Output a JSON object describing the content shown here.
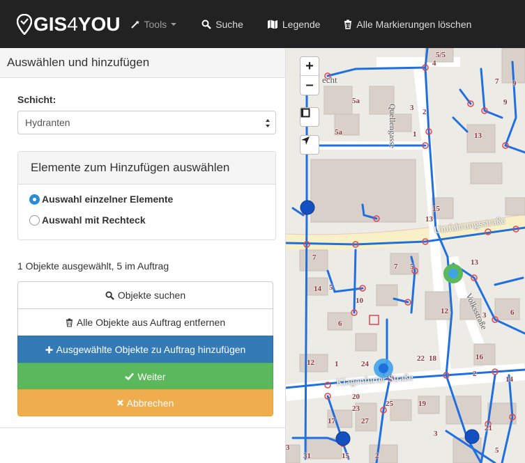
{
  "navbar": {
    "brand_main": "GIS",
    "brand_four": "4",
    "brand_you": "YOU",
    "tools_label": "Tools",
    "search_label": "Suche",
    "legend_label": "Legende",
    "clear_label": "Alle Markierungen löschen"
  },
  "sidebar": {
    "title": "Auswählen und hinzufügen",
    "layer_label": "Schicht:",
    "layer_value": "Hydranten",
    "choose_title": "Elemente zum Hinzufügen auswählen",
    "radio_single": "Auswahl einzelner Elemente",
    "radio_rect": "Auswahl mit Rechteck",
    "radio_selected": "single",
    "status": "1 Objekte ausgewählt, 5 im Auftrag",
    "btn_search": "Objekte suchen",
    "btn_remove_all": "Alle Objekte aus Auftrag entfernen",
    "btn_add": "Ausgewählte Objekte zu Auftrag hinzufügen",
    "btn_next": "Weiter",
    "btn_cancel": "Abbrechen"
  },
  "map": {
    "zoom_in": "+",
    "zoom_out": "–",
    "street_1": "Umfahrungsstraße",
    "street_2": "Klagenfurter Straße",
    "street_3": "Quellengasse",
    "street_4": "Volksstraße",
    "label_top": "echt",
    "house_numbers": [
      "5/5",
      "4",
      "7",
      "9",
      "9",
      "5a",
      "3",
      "2",
      "1",
      "5a",
      "13",
      "13",
      "15",
      "13",
      "7",
      "7",
      "5",
      "14",
      "5",
      "10",
      "12",
      "3",
      "6",
      "6",
      "22",
      "18",
      "16",
      "2",
      "14",
      "12",
      "1",
      "24",
      "20",
      "23",
      "25",
      "19",
      "17",
      "27",
      "21",
      "3",
      "15",
      "2",
      "3",
      "5",
      "31",
      "7"
    ],
    "colors": {
      "pipe": "#1f6fe0",
      "building": "#d9d0c9",
      "road": "#ffffff",
      "main_road": "#f8f1c8",
      "hydrant_selected": "#5cb85c",
      "hydrant_order": "#3fa3e8",
      "hydrant_plain": "#1550c0",
      "valve": "#e0454d"
    }
  }
}
